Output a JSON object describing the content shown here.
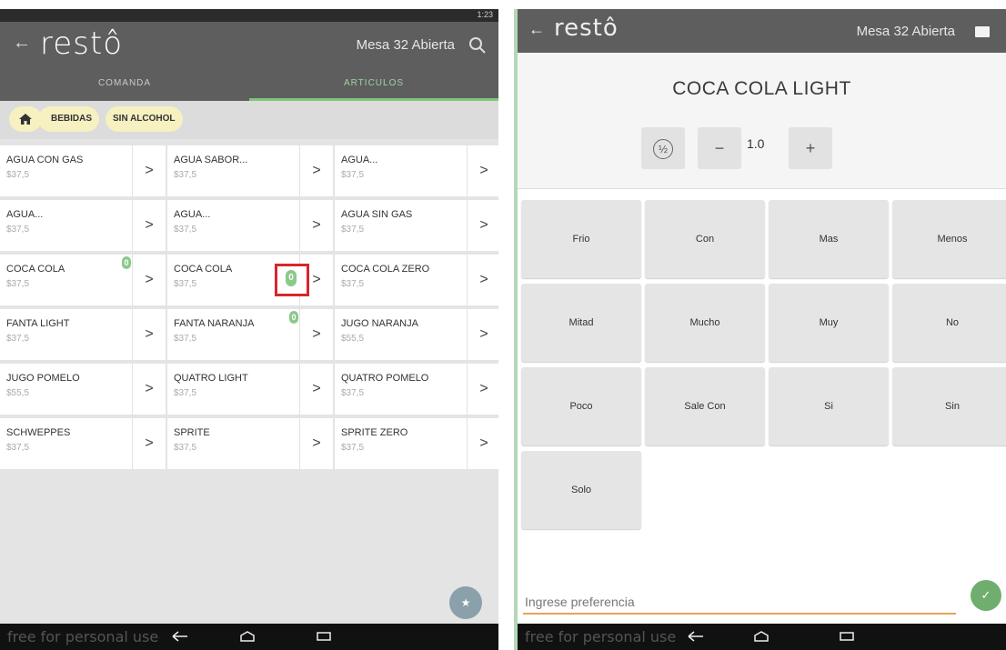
{
  "left": {
    "status_time": "1:23",
    "app_logo": "restô",
    "mesa_status": "Mesa 32  Abierta",
    "tabs": [
      {
        "label": "COMANDA"
      },
      {
        "label": "ARTICULOS"
      }
    ],
    "breadcrumb": [
      {
        "label": "BEBIDAS"
      },
      {
        "label": "SIN ALCOHOL"
      }
    ],
    "articles": [
      {
        "name": "AGUA CON GAS",
        "price": "$37,5"
      },
      {
        "name": "AGUA SABOR...",
        "price": "$37,5"
      },
      {
        "name": "AGUA...",
        "price": "$37,5"
      },
      {
        "name": "AGUA...",
        "price": "$37,5"
      },
      {
        "name": "AGUA...",
        "price": "$37,5"
      },
      {
        "name": "AGUA SIN GAS",
        "price": "$37,5"
      },
      {
        "name": "COCA COLA",
        "price": "$37,5",
        "badge": "0"
      },
      {
        "name": "COCA COLA",
        "price": "$37,5"
      },
      {
        "name": "COCA COLA ZERO",
        "price": "$37,5"
      },
      {
        "name": "FANTA LIGHT",
        "price": "$37,5"
      },
      {
        "name": "FANTA NARANJA",
        "price": "$37,5",
        "badge": "0"
      },
      {
        "name": "JUGO NARANJA",
        "price": "$55,5"
      },
      {
        "name": "JUGO POMELO",
        "price": "$55,5"
      },
      {
        "name": "QUATRO LIGHT",
        "price": "$37,5"
      },
      {
        "name": "QUATRO POMELO",
        "price": "$37,5"
      },
      {
        "name": "SCHWEPPES",
        "price": "$37,5"
      },
      {
        "name": "SPRITE",
        "price": "$37,5"
      },
      {
        "name": "SPRITE ZERO",
        "price": "$37,5"
      }
    ],
    "highlight_badge": "0",
    "arrow_glyph": ">",
    "fab_glyph": "★",
    "watermark": "free for personal use"
  },
  "right": {
    "app_logo": "restô",
    "mesa_status": "Mesa 32  Abierta",
    "product_title": "COCA COLA LIGHT",
    "half_label": "½",
    "minus_label": "−",
    "quantity": "1.0",
    "plus_label": "+",
    "options": [
      "Frio",
      "Con",
      "Mas",
      "Menos",
      "Mitad",
      "Mucho",
      "Muy",
      "No",
      "Poco",
      "Sale Con",
      "Si",
      "Sin",
      "Solo"
    ],
    "preference_placeholder": "Ingrese preferencia",
    "confirm_glyph": "✓",
    "watermark": "free for personal use"
  }
}
